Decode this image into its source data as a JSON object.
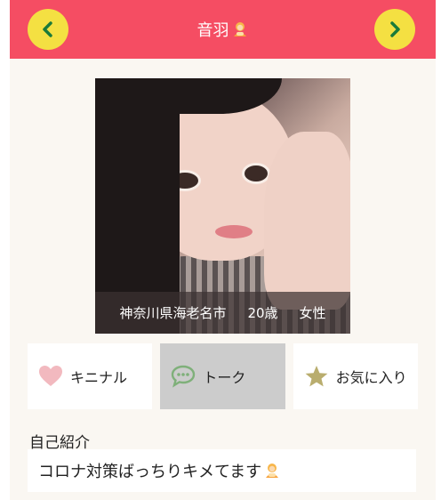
{
  "header": {
    "title": "音羽",
    "prev_icon": "chevron-left-icon",
    "next_icon": "chevron-right-icon",
    "bg_color": "#f54d63",
    "nav_color": "#f4e042"
  },
  "profile": {
    "location": "神奈川県海老名市",
    "age": "20歳",
    "gender": "女性"
  },
  "actions": [
    {
      "label": "キニナル",
      "icon": "heart-icon"
    },
    {
      "label": "トーク",
      "icon": "chat-bubble-icon",
      "active": true
    },
    {
      "label": "お気に入り",
      "icon": "star-icon"
    }
  ],
  "intro": {
    "label": "自己紹介",
    "text": "コロナ対策ばっちりキメてます"
  }
}
